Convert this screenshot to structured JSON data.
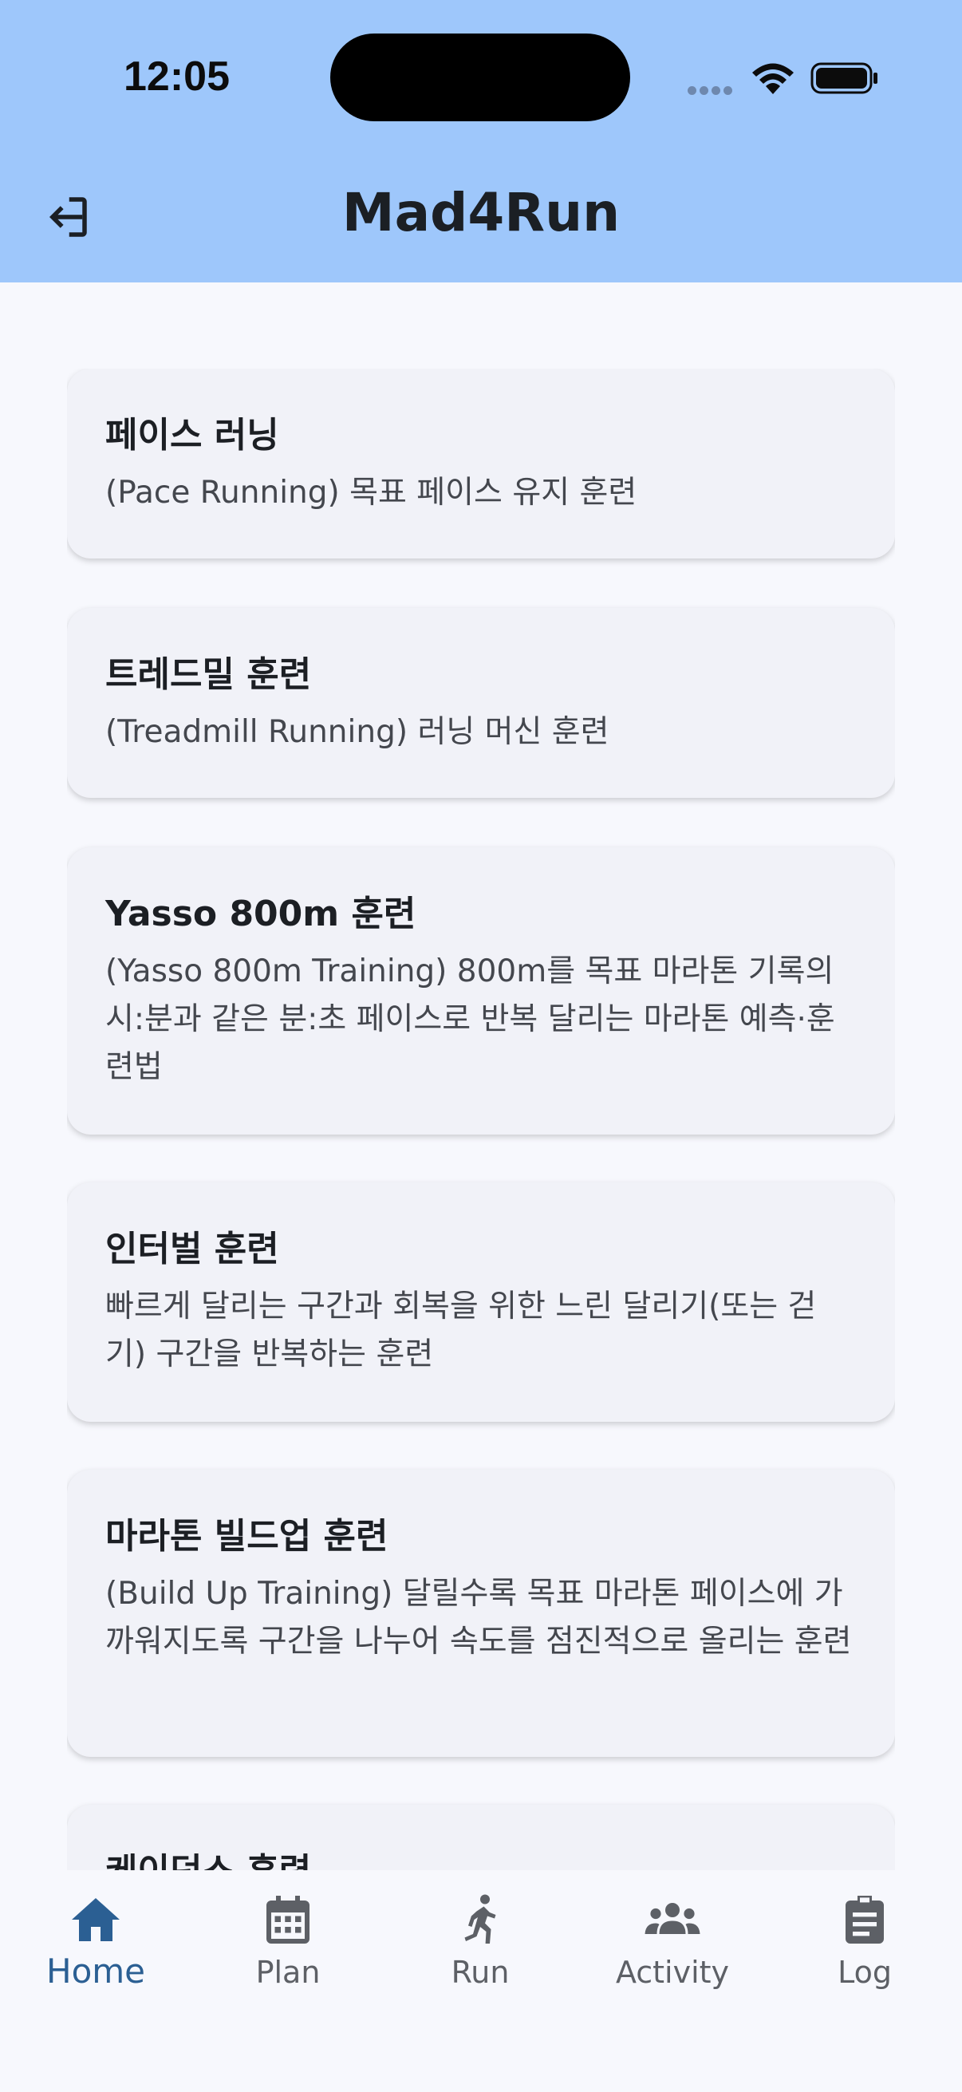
{
  "status_bar": {
    "time": "12:05"
  },
  "header": {
    "title": "Mad4Run"
  },
  "cards": [
    {
      "title": "페이스 러닝",
      "desc": "(Pace Running) 목표 페이스 유지 훈련"
    },
    {
      "title": "트레드밀 훈련",
      "desc": "(Treadmill Running) 러닝 머신 훈련"
    },
    {
      "title": "Yasso 800m 훈련",
      "desc": "(Yasso 800m Training) 800m를 목표 마라톤 기록의 시:분과 같은 분:초 페이스로 반복 달리는 마라톤 예측·훈련법"
    },
    {
      "title": "인터벌 훈련",
      "desc": "빠르게 달리는 구간과 회복을 위한 느린 달리기(또는 걷기) 구간을 반복하는 훈련"
    },
    {
      "title": "마라톤 빌드업 훈련",
      "desc": "(Build Up Training) 달릴수록 목표 마라톤 페이스에 가까워지도록 구간을 나누어 속도를 점진적으로 올리는 훈련"
    },
    {
      "title": "케이던스 훈련",
      "desc": ""
    }
  ],
  "tabs": [
    {
      "label": "Home",
      "icon": "home-icon",
      "active": true
    },
    {
      "label": "Plan",
      "icon": "calendar-icon",
      "active": false
    },
    {
      "label": "Run",
      "icon": "runner-icon",
      "active": false
    },
    {
      "label": "Activity",
      "icon": "group-icon",
      "active": false
    },
    {
      "label": "Log",
      "icon": "clipboard-icon",
      "active": false
    }
  ],
  "colors": {
    "header_bg": "#9ec7fb",
    "active_tab": "#2b5f93",
    "inactive_tab": "#5d6066",
    "card_bg": "#f1f2f8"
  }
}
